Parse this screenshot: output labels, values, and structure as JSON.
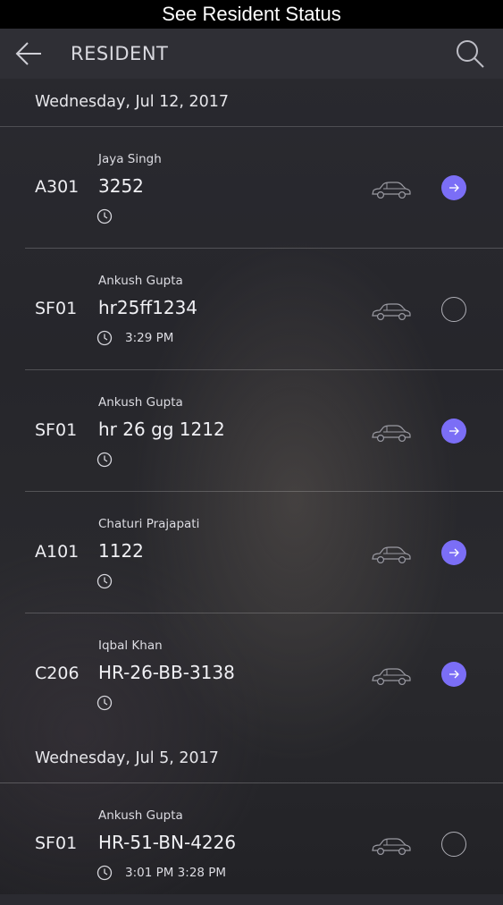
{
  "caption": "See Resident Status",
  "appbar": {
    "title": "RESIDENT",
    "back_icon": "arrow-left-icon",
    "search_icon": "search-icon"
  },
  "colors": {
    "accent": "#7b6ef6"
  },
  "groups": [
    {
      "date": "Wednesday, Jul 12, 2017",
      "entries": [
        {
          "unit": "A301",
          "name": "Jaya Singh",
          "plate": "3252",
          "times": "",
          "status": "active"
        },
        {
          "unit": "SF01",
          "name": "Ankush Gupta",
          "plate": "hr25ff1234",
          "times": "3:29 PM",
          "status": "empty"
        },
        {
          "unit": "SF01",
          "name": "Ankush Gupta",
          "plate": "hr 26 gg 1212",
          "times": "",
          "status": "active"
        },
        {
          "unit": "A101",
          "name": "Chaturi Prajapati",
          "plate": "1122",
          "times": "",
          "status": "active"
        },
        {
          "unit": "C206",
          "name": "Iqbal Khan",
          "plate": "HR-26-BB-3138",
          "times": "",
          "status": "active"
        }
      ]
    },
    {
      "date": "Wednesday, Jul 5, 2017",
      "entries": [
        {
          "unit": "SF01",
          "name": "Ankush Gupta",
          "plate": "HR-51-BN-4226",
          "times": "3:01 PM 3:28 PM",
          "status": "empty"
        }
      ]
    }
  ]
}
